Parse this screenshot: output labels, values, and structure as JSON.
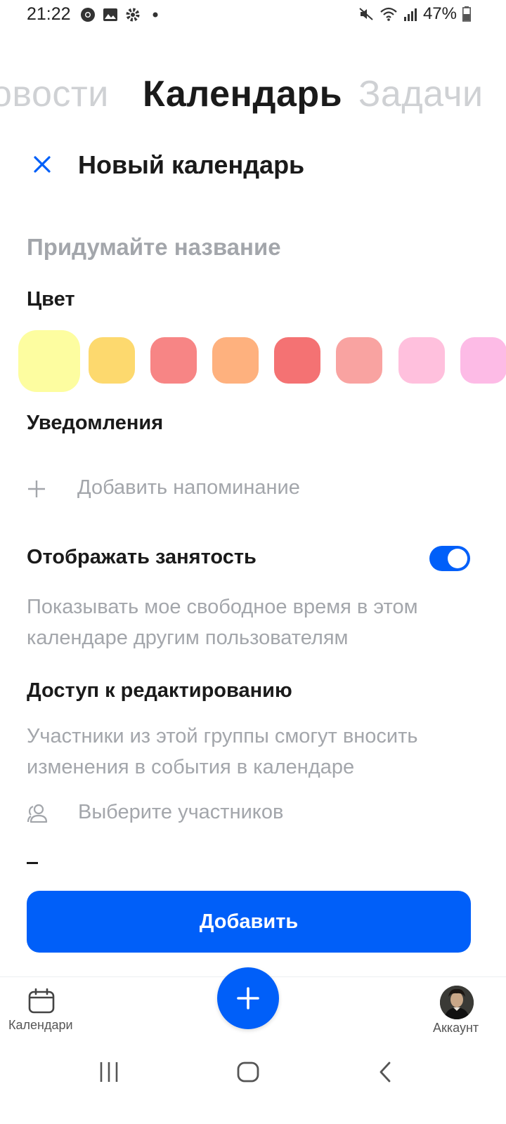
{
  "status_bar": {
    "time": "21:22",
    "battery": "47%",
    "left_icons": [
      "chrome-icon",
      "gallery-icon",
      "settings-icon",
      "dot-icon"
    ],
    "right_icons": [
      "mute-icon",
      "wifi-icon",
      "signal-icon",
      "battery-icon"
    ]
  },
  "tabs": [
    {
      "label": "овости",
      "active": false
    },
    {
      "label": "Календарь",
      "active": true
    },
    {
      "label": "Задачи",
      "active": false
    }
  ],
  "header": {
    "title": "Новый календарь",
    "close_icon": "close-icon"
  },
  "form": {
    "name_placeholder": "Придумайте название",
    "color_label": "Цвет",
    "colors": [
      "#fdfda0",
      "#fdd96e",
      "#f78585",
      "#feb17e",
      "#f47273",
      "#f9a3a1",
      "#ffc0dd",
      "#fdbbe6"
    ],
    "selected_color_index": 0,
    "notifications_label": "Уведомления",
    "add_reminder": "Добавить напоминание",
    "busy_label": "Отображать занятость",
    "busy_enabled": true,
    "busy_description": "Показывать мое свободное время в этом календаре другим пользователям",
    "access_label": "Доступ к редактированию",
    "access_description": "Участники из этой группы смогут вносить изменения в события в календаре",
    "participants_placeholder": "Выберите участников",
    "submit_label": "Добавить"
  },
  "bottom_nav": {
    "calendars_label": "Календари",
    "account_label": "Аккаунт",
    "fab_icon": "plus-icon"
  },
  "accent_color": "#005ff9"
}
